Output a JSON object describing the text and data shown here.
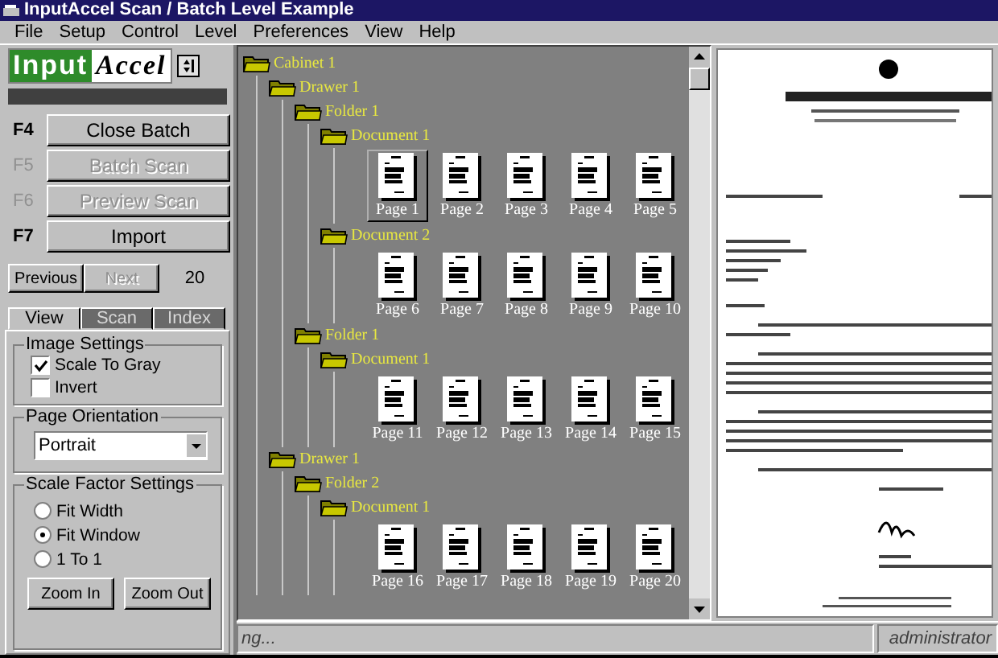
{
  "window": {
    "title": "InputAccel Scan / Batch Level Example"
  },
  "menu": [
    "File",
    "Setup",
    "Control",
    "Level",
    "Preferences",
    "View",
    "Help"
  ],
  "logo": {
    "part_1": "Input",
    "part_2": "Accel"
  },
  "batch_buttons": [
    {
      "key": "F4",
      "label": "Close Batch",
      "disabled": false
    },
    {
      "key": "F5",
      "label": "Batch Scan",
      "disabled": true
    },
    {
      "key": "F6",
      "label": "Preview Scan",
      "disabled": true
    },
    {
      "key": "F7",
      "label": "Import",
      "disabled": false
    }
  ],
  "navigation": {
    "previous": {
      "label": "Previous",
      "disabled": false
    },
    "next": {
      "label": "Next",
      "disabled": true
    },
    "count": "20"
  },
  "tabs": [
    {
      "label": "View",
      "selected": true
    },
    {
      "label": "Scan",
      "selected": false
    },
    {
      "label": "Index",
      "selected": false
    }
  ],
  "image_settings": {
    "title": "Image Settings",
    "options": [
      {
        "label": "Scale To Gray",
        "checked": true
      },
      {
        "label": "Invert",
        "checked": false
      }
    ]
  },
  "page_orientation": {
    "title": "Page Orientation",
    "value": "Portrait"
  },
  "scale_factor": {
    "title": "Scale Factor Settings",
    "options": [
      {
        "label": "Fit Width",
        "selected": false
      },
      {
        "label": "Fit Window",
        "selected": true
      },
      {
        "label": "1 To 1",
        "selected": false
      }
    ],
    "buttons": [
      "Zoom In",
      "Zoom Out"
    ]
  },
  "tree": {
    "label": "Cabinet 1",
    "children": [
      {
        "label": "Drawer 1",
        "children": [
          {
            "label": "Folder 1",
            "children": [
              {
                "label": "Document 1",
                "pages": [
                  {
                    "label": "Page 1",
                    "selected": true
                  },
                  {
                    "label": "Page 2",
                    "selected": false
                  },
                  {
                    "label": "Page 3",
                    "selected": false
                  },
                  {
                    "label": "Page 4",
                    "selected": false
                  },
                  {
                    "label": "Page 5",
                    "selected": false
                  }
                ]
              },
              {
                "label": "Document 2",
                "pages": [
                  {
                    "label": "Page 6",
                    "selected": false
                  },
                  {
                    "label": "Page 7",
                    "selected": false
                  },
                  {
                    "label": "Page 8",
                    "selected": false
                  },
                  {
                    "label": "Page 9",
                    "selected": false
                  },
                  {
                    "label": "Page 10",
                    "selected": false
                  }
                ]
              }
            ]
          },
          {
            "label": "Folder 1",
            "children": [
              {
                "label": "Document 1",
                "pages": [
                  {
                    "label": "Page 11",
                    "selected": false
                  },
                  {
                    "label": "Page 12",
                    "selected": false
                  },
                  {
                    "label": "Page 13",
                    "selected": false
                  },
                  {
                    "label": "Page 14",
                    "selected": false
                  },
                  {
                    "label": "Page 15",
                    "selected": false
                  }
                ]
              }
            ]
          }
        ]
      },
      {
        "label": "Drawer 1",
        "children": [
          {
            "label": "Folder 2",
            "children": [
              {
                "label": "Document 1",
                "pages": [
                  {
                    "label": "Page 16",
                    "selected": false
                  },
                  {
                    "label": "Page 17",
                    "selected": false
                  },
                  {
                    "label": "Page 18",
                    "selected": false
                  },
                  {
                    "label": "Page 19",
                    "selected": false
                  },
                  {
                    "label": "Page 20",
                    "selected": false
                  }
                ]
              }
            ]
          }
        ]
      }
    ]
  },
  "status_bar": {
    "message": "ng...",
    "user": "administrator"
  }
}
